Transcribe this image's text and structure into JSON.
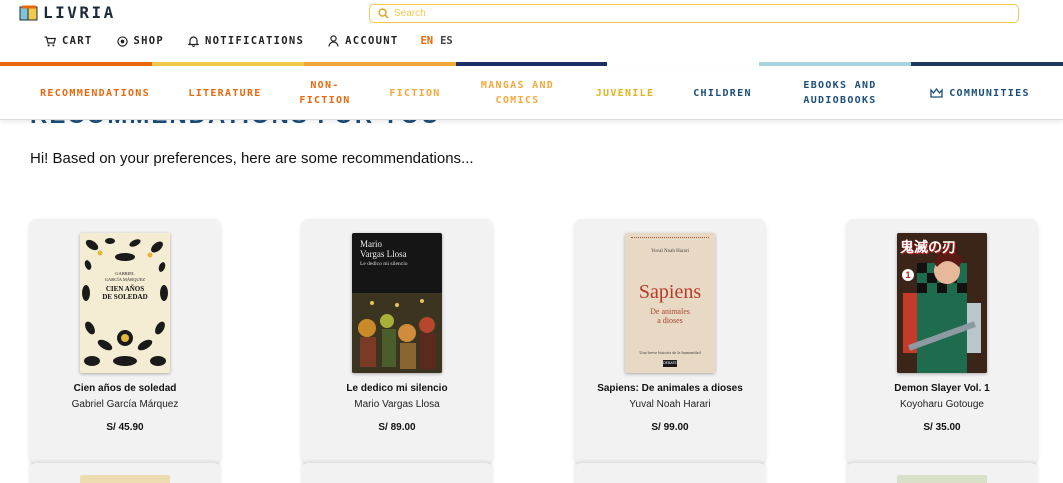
{
  "app": {
    "logo_text": "LIVRIA"
  },
  "search": {
    "placeholder": "Search"
  },
  "topnav": {
    "cart": "CART",
    "shop": "SHOP",
    "notifications": "NOTIFICATIONS",
    "account": "ACCOUNT",
    "lang_active": "EN",
    "lang_other": "ES"
  },
  "stripe_colors": [
    "#e8680d",
    "#f2c94c",
    "#f5a83a",
    "#1b2f66",
    "#ffffff",
    "#a9d3df",
    "#1c3a5e"
  ],
  "categories": [
    {
      "label": "RECOMMENDATIONS",
      "color": "#e8680d"
    },
    {
      "label": "LITERATURE",
      "color": "#e8680d"
    },
    {
      "label": "NON-\nFICTION",
      "color": "#e8680d"
    },
    {
      "label": "FICTION",
      "color": "#f5a83a"
    },
    {
      "label": "MANGAS AND\nCOMICS",
      "color": "#f5a83a"
    },
    {
      "label": "JUVENILE",
      "color": "#e0b51f"
    },
    {
      "label": "CHILDREN",
      "color": "#1b4e7a"
    },
    {
      "label": "EBOOKS AND\nAUDIOBOOKS",
      "color": "#1b4e7a"
    },
    {
      "label": "COMMUNITIES",
      "color": "#1b4e7a",
      "icon": "crown-icon"
    }
  ],
  "main": {
    "section_title": "RECOMMENDATIONS FOR YOU",
    "intro": "Hi! Based on your preferences, here are some recommendations..."
  },
  "books": [
    {
      "title": "Cien años de soledad",
      "author": "Gabriel García Márquez",
      "price": "S/ 45.90",
      "cover": {
        "line1": "GABRIEL",
        "line2": "GARCÍA MÁRQUEZ",
        "line3": "CIEN AÑOS",
        "line4": "DE SOLEDAD"
      }
    },
    {
      "title": "Le dedico mi silencio",
      "author": "Mario Vargas Llosa",
      "price": "S/ 89.00",
      "cover": {
        "line1": "Mario",
        "line2": "Vargas Llosa",
        "line3": "Le dedico mi silencio"
      }
    },
    {
      "title": "Sapiens: De animales a dioses",
      "author": "Yuval Noah Harari",
      "price": "S/ 99.00",
      "cover": {
        "line1": "Yuval Noah Harari",
        "line2": "Sapiens",
        "line3": "De animales",
        "line4": "a dioses",
        "line5": "Una breve historia de la humanidad",
        "line6": "DEBATE"
      }
    },
    {
      "title": "Demon Slayer Vol. 1",
      "author": "Koyoharu Gotouge",
      "price": "S/ 35.00",
      "cover": {
        "line1": "鬼滅の刃",
        "line2": "1"
      }
    }
  ]
}
